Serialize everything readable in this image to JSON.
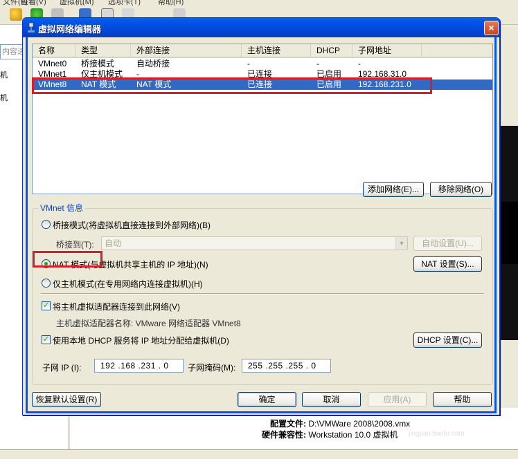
{
  "background": {
    "menu_items": [
      "文件(F)",
      "查看(V)",
      "虚拟机(M)",
      "选项卡(T)",
      "帮助(H)"
    ],
    "search_placeholder": "内容进",
    "left_items": [
      "机",
      "机"
    ],
    "info": [
      {
        "label": "配置文件:",
        "value": "D:\\VMWare 2008\\2008.vmx"
      },
      {
        "label": "硬件兼容性:",
        "value": "Workstation 10.0 虚拟机"
      }
    ]
  },
  "dialog": {
    "title": "虚拟网络编辑器",
    "close_label": "×",
    "table": {
      "columns": [
        "名称",
        "类型",
        "外部连接",
        "主机连接",
        "DHCP",
        "子网地址"
      ],
      "rows": [
        [
          "VMnet0",
          "桥接模式",
          "自动桥接",
          "-",
          "-",
          "-"
        ],
        [
          "VMnet1",
          "仅主机模式",
          "-",
          "已连接",
          "已启用",
          "192.168.31.0"
        ],
        [
          "VMnet8",
          "NAT 模式",
          "NAT 模式",
          "已连接",
          "已启用",
          "192.168.231.0"
        ]
      ],
      "selected_row": 2
    },
    "add_network_label": "添加网络(E)...",
    "remove_network_label": "移除网络(O)",
    "vmnet_info": {
      "group_title": "VMnet 信息",
      "bridge_mode_label": "桥接模式(将虚拟机直接连接到外部网络)(B)",
      "bridge_to_label": "桥接到(T):",
      "bridge_to_value": "自动",
      "auto_settings_label": "自动设置(U)...",
      "nat_mode_label": "NAT 模式(与虚拟机共享主机的 IP 地址)(N)",
      "nat_settings_label": "NAT 设置(S)...",
      "host_only_label": "仅主机模式(在专用网络内连接虚拟机)(H)",
      "connect_adapter_label": "将主机虚拟适配器连接到此网络(V)",
      "adapter_name_text": "主机虚拟适配器名称: VMware 网络适配器 VMnet8",
      "use_dhcp_label": "使用本地 DHCP 服务将 IP 地址分配给虚拟机(D)",
      "dhcp_settings_label": "DHCP 设置(C)...",
      "subnet_ip_label": "子网 IP (I):",
      "subnet_ip_value": "192 .168 .231 .  0",
      "subnet_mask_label": "子网掩码(M):",
      "subnet_mask_value": "255 .255 .255 .  0",
      "selected_mode": "nat",
      "connect_adapter_checked": true,
      "use_dhcp_checked": true
    },
    "restore_defaults_label": "恢复默认设置(R)",
    "ok_label": "确定",
    "cancel_label": "取消",
    "apply_label": "应用(A)",
    "help_label": "帮助"
  },
  "watermark": {
    "text": "Bai 经验",
    "subtext": "jingyan.baidu.com"
  },
  "colors": {
    "selection": "#316ac5",
    "titlebar": "#0055ea",
    "highlight_box": "#d4202a",
    "group_label": "#0046d5"
  }
}
